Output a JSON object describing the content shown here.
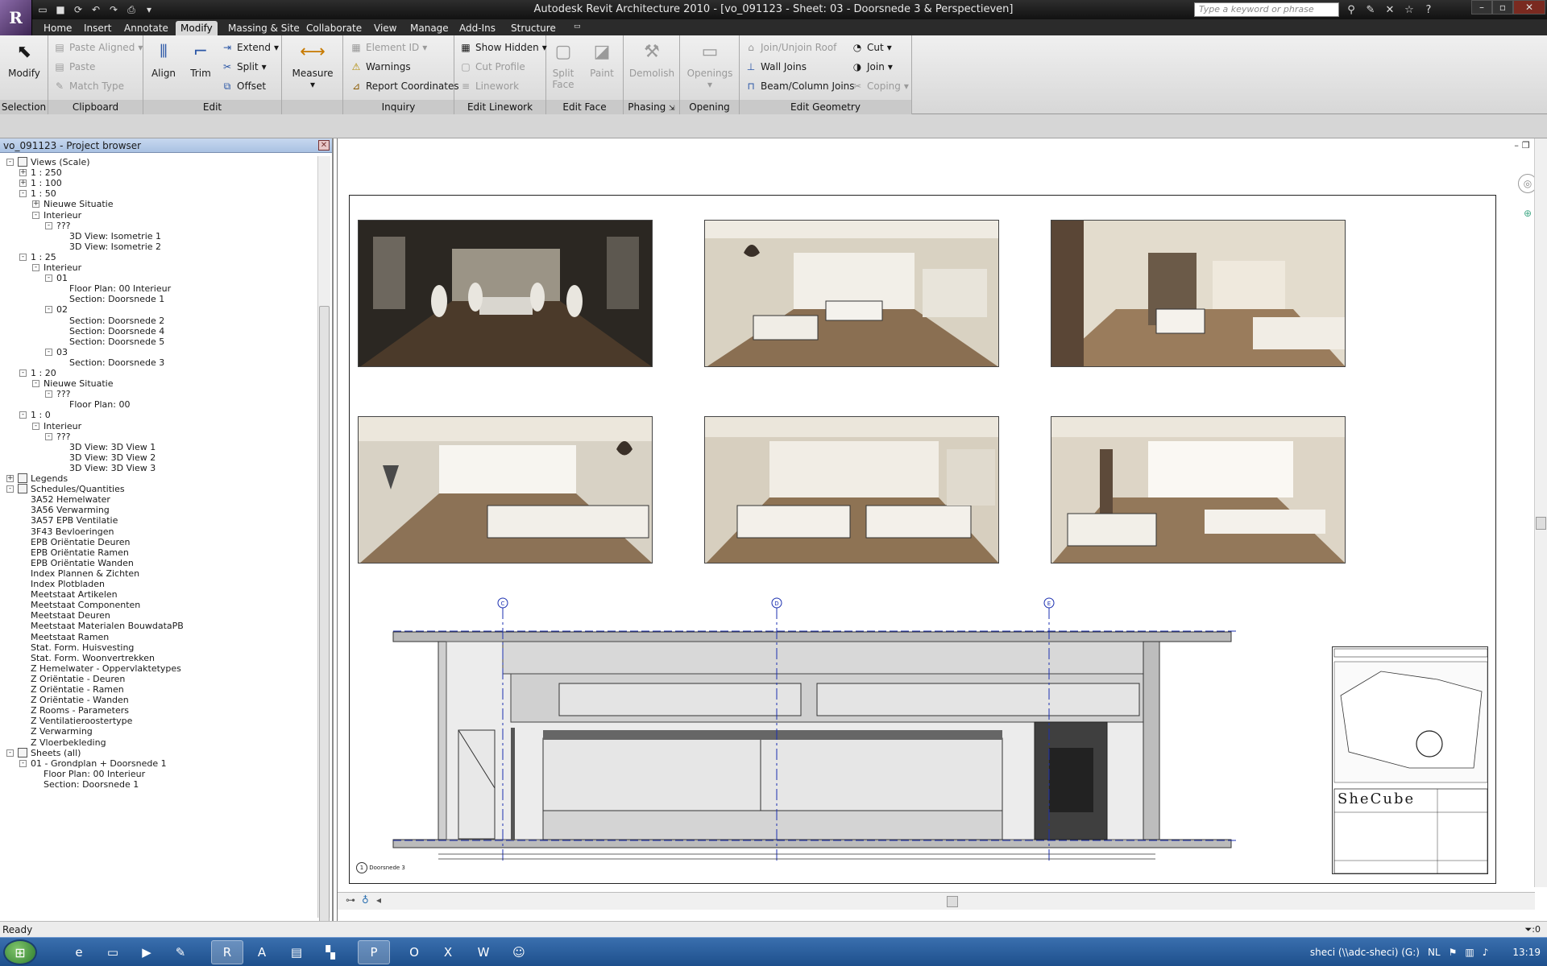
{
  "app": {
    "logo": "R",
    "title": "Autodesk Revit Architecture 2010 - [vo_091123 - Sheet: 03 - Doorsnede 3 & Perspectieven]",
    "search_placeholder": "Type a keyword or phrase"
  },
  "tabs": [
    "Home",
    "Insert",
    "Annotate",
    "Modify",
    "Massing & Site",
    "Collaborate",
    "View",
    "Manage",
    "Add-Ins",
    "Structure"
  ],
  "active_tab": "Modify",
  "ribbon": {
    "selection": {
      "title": "Selection",
      "modify": "Modify"
    },
    "clipboard": {
      "title": "Clipboard",
      "paste_aligned": "Paste Aligned",
      "paste": "Paste",
      "match_type": "Match Type"
    },
    "edit": {
      "title": "Edit",
      "align": "Align",
      "trim": "Trim",
      "extend": "Extend",
      "split": "Split",
      "offset": "Offset",
      "measure": "Measure"
    },
    "inquiry": {
      "title": "Inquiry",
      "element_id": "Element ID",
      "warnings": "Warnings",
      "report_coordinates": "Report Coordinates"
    },
    "edit_linework": {
      "title": "Edit Linework",
      "show_hidden": "Show Hidden",
      "cut_profile": "Cut Profile",
      "linework": "Linework"
    },
    "edit_face": {
      "title": "Edit Face",
      "split_face": "Split Face",
      "paint": "Paint"
    },
    "phasing": {
      "title": "Phasing",
      "demolish": "Demolish"
    },
    "opening": {
      "title": "Opening",
      "openings": "Openings"
    },
    "edit_geometry": {
      "title": "Edit Geometry",
      "join_unjoin_roof": "Join/Unjoin Roof",
      "wall_joins": "Wall Joins",
      "beam_column_joins": "Beam/Column Joins",
      "cut": "Cut",
      "join": "Join",
      "coping": "Coping"
    }
  },
  "browser": {
    "title": "vo_091123 - Project browser",
    "rows": [
      {
        "label": "Views (Scale)",
        "level": 0,
        "exp": "-"
      },
      {
        "label": "1 : 250",
        "level": 1,
        "exp": "+"
      },
      {
        "label": "1 : 100",
        "level": 1,
        "exp": "+"
      },
      {
        "label": "1 : 50",
        "level": 1,
        "exp": "-"
      },
      {
        "label": "Nieuwe Situatie",
        "level": 2,
        "exp": "+"
      },
      {
        "label": "Interieur",
        "level": 2,
        "exp": "-"
      },
      {
        "label": "???",
        "level": 3,
        "exp": "-"
      },
      {
        "label": "3D View: Isometrie 1",
        "level": 4,
        "exp": ""
      },
      {
        "label": "3D View: Isometrie 2",
        "level": 4,
        "exp": ""
      },
      {
        "label": "1 : 25",
        "level": 1,
        "exp": "-"
      },
      {
        "label": "Interieur",
        "level": 2,
        "exp": "-"
      },
      {
        "label": "01",
        "level": 3,
        "exp": "-"
      },
      {
        "label": "Floor Plan: 00 Interieur",
        "level": 4,
        "exp": ""
      },
      {
        "label": "Section: Doorsnede 1",
        "level": 4,
        "exp": ""
      },
      {
        "label": "02",
        "level": 3,
        "exp": "-"
      },
      {
        "label": "Section: Doorsnede 2",
        "level": 4,
        "exp": ""
      },
      {
        "label": "Section: Doorsnede 4",
        "level": 4,
        "exp": ""
      },
      {
        "label": "Section: Doorsnede 5",
        "level": 4,
        "exp": ""
      },
      {
        "label": "03",
        "level": 3,
        "exp": "-"
      },
      {
        "label": "Section: Doorsnede 3",
        "level": 4,
        "exp": ""
      },
      {
        "label": "1 : 20",
        "level": 1,
        "exp": "-"
      },
      {
        "label": "Nieuwe Situatie",
        "level": 2,
        "exp": "-"
      },
      {
        "label": "???",
        "level": 3,
        "exp": "-"
      },
      {
        "label": "Floor Plan: 00",
        "level": 4,
        "exp": ""
      },
      {
        "label": "1 : 0",
        "level": 1,
        "exp": "-"
      },
      {
        "label": "Interieur",
        "level": 2,
        "exp": "-"
      },
      {
        "label": "???",
        "level": 3,
        "exp": "-"
      },
      {
        "label": "3D View: 3D View 1",
        "level": 4,
        "exp": ""
      },
      {
        "label": "3D View: 3D View 2",
        "level": 4,
        "exp": ""
      },
      {
        "label": "3D View: 3D View 3",
        "level": 4,
        "exp": ""
      },
      {
        "label": "Legends",
        "level": 0,
        "exp": "+"
      },
      {
        "label": "Schedules/Quantities",
        "level": 0,
        "exp": "-"
      },
      {
        "label": "3A52 Hemelwater",
        "level": 1,
        "exp": ""
      },
      {
        "label": "3A56 Verwarming",
        "level": 1,
        "exp": ""
      },
      {
        "label": "3A57 EPB Ventilatie",
        "level": 1,
        "exp": ""
      },
      {
        "label": "3F43 Bevloeringen",
        "level": 1,
        "exp": ""
      },
      {
        "label": "EPB Oriëntatie Deuren",
        "level": 1,
        "exp": ""
      },
      {
        "label": "EPB Oriëntatie Ramen",
        "level": 1,
        "exp": ""
      },
      {
        "label": "EPB Oriëntatie Wanden",
        "level": 1,
        "exp": ""
      },
      {
        "label": "Index Plannen & Zichten",
        "level": 1,
        "exp": ""
      },
      {
        "label": "Index Plotbladen",
        "level": 1,
        "exp": ""
      },
      {
        "label": "Meetstaat Artikelen",
        "level": 1,
        "exp": ""
      },
      {
        "label": "Meetstaat Componenten",
        "level": 1,
        "exp": ""
      },
      {
        "label": "Meetstaat Deuren",
        "level": 1,
        "exp": ""
      },
      {
        "label": "Meetstaat Materialen BouwdataPB",
        "level": 1,
        "exp": ""
      },
      {
        "label": "Meetstaat Ramen",
        "level": 1,
        "exp": ""
      },
      {
        "label": "Stat. Form. Huisvesting",
        "level": 1,
        "exp": ""
      },
      {
        "label": "Stat. Form. Woonvertrekken",
        "level": 1,
        "exp": ""
      },
      {
        "label": "Z Hemelwater - Oppervlaktetypes",
        "level": 1,
        "exp": ""
      },
      {
        "label": "Z Oriëntatie - Deuren",
        "level": 1,
        "exp": ""
      },
      {
        "label": "Z Oriëntatie - Ramen",
        "level": 1,
        "exp": ""
      },
      {
        "label": "Z Oriëntatie - Wanden",
        "level": 1,
        "exp": ""
      },
      {
        "label": "Z Rooms - Parameters",
        "level": 1,
        "exp": ""
      },
      {
        "label": "Z Ventilatieroostertype",
        "level": 1,
        "exp": ""
      },
      {
        "label": "Z Verwarming",
        "level": 1,
        "exp": ""
      },
      {
        "label": "Z Vloerbekleding",
        "level": 1,
        "exp": ""
      },
      {
        "label": "Sheets (all)",
        "level": 0,
        "exp": "-"
      },
      {
        "label": "01 - Grondplan + Doorsnede 1",
        "level": 1,
        "exp": "-"
      },
      {
        "label": "Floor Plan: 00 Interieur",
        "level": 2,
        "exp": ""
      },
      {
        "label": "Section: Doorsnede 1",
        "level": 2,
        "exp": ""
      }
    ]
  },
  "sheet": {
    "view_number": "1",
    "view_name": "Doorsnede 3",
    "grid_markers": [
      "C",
      "D",
      "E"
    ],
    "logo_text": "SheCube"
  },
  "status": {
    "text": "Ready",
    "filter": ":0"
  },
  "taskbar": {
    "tray_label": "sheci (\\\\adc-sheci) (G:)",
    "lang": "NL",
    "time": "13:19"
  }
}
